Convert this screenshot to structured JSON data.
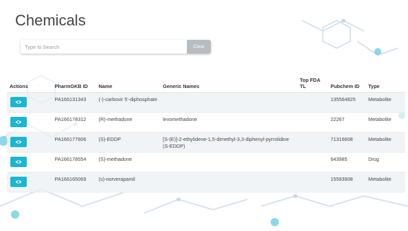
{
  "page": {
    "title": "Chemicals"
  },
  "search": {
    "placeholder": "Type to Search",
    "clear_label": "Clear"
  },
  "table": {
    "headers": {
      "actions": "Actions",
      "pharmgkb_id": "PharmGKB ID",
      "name": "Name",
      "generic_names": "Generic Names",
      "top_fda_tl": "Top FDA TL",
      "pubchem_id": "Pubchem ID",
      "type": "Type"
    },
    "rows": [
      {
        "id": "PA166131343",
        "name": "(-)-carbovir 5'-diphosphate",
        "generic": "",
        "fda": "",
        "pubchem": "135564825",
        "type": "Metabolite"
      },
      {
        "id": "PA166178312",
        "name": "(R)-methadone",
        "generic": "levomethadone",
        "fda": "",
        "pubchem": "22267",
        "type": "Metabolite"
      },
      {
        "id": "PA166177606",
        "name": "(S)-EDDP",
        "generic": "[S-(E)]-2-ethylidene-1,5-dimethyl-3,3-diphenyl-pyrrolidine (S-EDDP)",
        "fda": "",
        "pubchem": "71316608",
        "type": "Metabolite"
      },
      {
        "id": "PA166178554",
        "name": "(S)-methadone",
        "generic": "",
        "fda": "",
        "pubchem": "643985",
        "type": "Drug"
      },
      {
        "id": "PA166165069",
        "name": "(s)-norverapamil",
        "generic": "",
        "fda": "",
        "pubchem": "15593908",
        "type": "Metabolite"
      }
    ],
    "action_icon": "eye-icon"
  },
  "colors": {
    "accent": "#19b7d3",
    "clear_button": "#b5bcc2",
    "row_stripe": "#ecf0f3"
  }
}
